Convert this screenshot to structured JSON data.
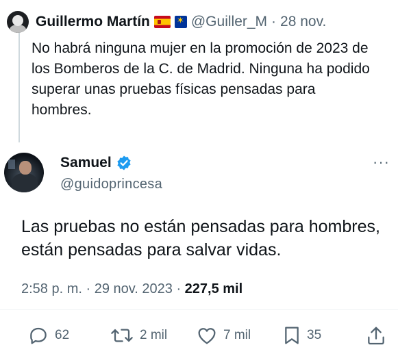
{
  "quoted": {
    "name": "Guillermo Martín",
    "handle": "@Guiller_M",
    "separator": "·",
    "date": "28 nov.",
    "text": "No habrá ninguna mujer en la promoción de 2023 de los Bomberos de la C. de Madrid. Ninguna ha podido superar unas pruebas físicas pensadas para hombres."
  },
  "tweet": {
    "name": "Samuel",
    "handle": "@guidoprincesa",
    "text": "Las pruebas no están pensadas para hombres, están pensadas para salvar vidas.",
    "time": "2:58 p. m.",
    "date": "29 nov. 2023",
    "views": "227,5 mil",
    "more": "···"
  },
  "actions": {
    "replies": "62",
    "retweets": "2 mil",
    "likes": "7 mil",
    "bookmarks": "35"
  },
  "icons": {
    "quoted_flags": [
      "spain-flag-icon",
      "eu-flag-icon"
    ],
    "verified": "verified-badge-icon",
    "bar": [
      "reply-icon",
      "retweet-icon",
      "like-icon",
      "bookmark-icon",
      "share-icon"
    ]
  },
  "colors": {
    "text": "#0f1419",
    "secondary": "#536471",
    "verified": "#1d9bf0",
    "divider": "#eff3f4"
  }
}
